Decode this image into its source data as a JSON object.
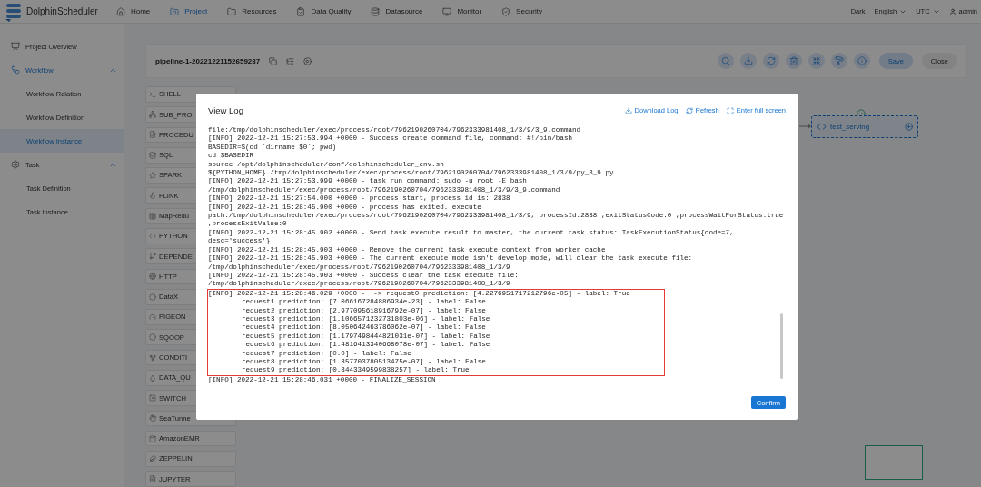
{
  "header": {
    "brand": "DolphinScheduler",
    "nav": [
      {
        "label": "Home",
        "selected": false
      },
      {
        "label": "Project",
        "selected": true
      },
      {
        "label": "Resources",
        "selected": false
      },
      {
        "label": "Data Quality",
        "selected": false
      },
      {
        "label": "Datasource",
        "selected": false
      },
      {
        "label": "Monitor",
        "selected": false
      },
      {
        "label": "Security",
        "selected": false
      }
    ],
    "theme": "Dark",
    "language": "English",
    "timezone": "UTC",
    "user": "admin"
  },
  "sidebar": {
    "items": [
      {
        "label": "Project Overview",
        "selected": false
      },
      {
        "label": "Workflow",
        "selected": false,
        "expanded": true,
        "children": [
          {
            "label": "Workflow Relation",
            "selected": false
          },
          {
            "label": "Workflow Definition",
            "selected": false
          },
          {
            "label": "Workflow Instance",
            "selected": true
          }
        ]
      },
      {
        "label": "Task",
        "selected": false,
        "expanded": true,
        "children": [
          {
            "label": "Task Definition",
            "selected": false
          },
          {
            "label": "Task Instance",
            "selected": false
          }
        ]
      }
    ]
  },
  "toolbar": {
    "title": "pipeline-1-20221221152659237",
    "buttons": [
      "Save",
      "Close"
    ]
  },
  "palette": [
    "SHELL",
    "SUB_PRO",
    "PROCEDU",
    "SQL",
    "SPARK",
    "FLINK",
    "MapRedu",
    "PYTHON",
    "DEPENDE",
    "HTTP",
    "DataX",
    "PIGEON",
    "SQOOP",
    "CONDITI",
    "DATA_QU",
    "SWITCH",
    "SeaTunne",
    "AmazonEMR",
    "ZEPPELIN",
    "JUPYTER"
  ],
  "canvas": {
    "node": {
      "label": "test_serving",
      "succeeded": true
    }
  },
  "dialog": {
    "title": "View Log",
    "actions": [
      "Download Log",
      "Refresh",
      "Enter full screen"
    ],
    "confirm": "Confirm",
    "log": [
      {
        "kind": "plain",
        "lines": [
          {
            "text": "file:/tmp/dolphinscheduler/exec/process/root/7962190260704/7962333981408_1/3/9/3_9.command"
          },
          {
            "text": "[INFO] 2022-12-21 15:27:53.994 +0000 - Success create command file, command: #!/bin/bash"
          },
          {
            "text": "BASEDIR=$(cd `dirname $0`; pwd)"
          },
          {
            "text": "cd $BASEDIR"
          },
          {
            "text": "source /opt/dolphinscheduler/conf/dolphinscheduler_env.sh"
          },
          {
            "text": "${PYTHON_HOME} /tmp/dolphinscheduler/exec/process/root/7962190260704/7962333981408_1/3/9/py_3_9.py"
          },
          {
            "text": "[INFO] 2022-12-21 15:27:53.999 +0000 - task run command: sudo -u root -E bash"
          },
          {
            "text": "/tmp/dolphinscheduler/exec/process/root/7962190260704/7962333981408_1/3/9/3_9.command"
          },
          {
            "text": "[INFO] 2022-12-21 15:27:54.000 +0000 - process start, process id is: 2838"
          },
          {
            "text": "[INFO] 2022-12-21 15:28:45.900 +0000 - process has exited. execute"
          },
          {
            "text": "path:/tmp/dolphinscheduler/exec/process/root/7962190260704/7962333981408_1/3/9, processId:2838 ,exitStatusCode:0 ,processWaitForStatus:true"
          },
          {
            "text": ",processExitValue:0"
          },
          {
            "text": "[INFO] 2022-12-21 15:28:45.902 +0000 - Send task execute result to master, the current task status: TaskExecutionStatus{code=7,"
          },
          {
            "text": "desc='success'}"
          },
          {
            "text": "[INFO] 2022-12-21 15:28:45.903 +0000 - Remove the current task execute context from worker cache"
          },
          {
            "text": "[INFO] 2022-12-21 15:28:45.903 +0000 - The current execute mode isn't develop mode, will clear the task execute file:"
          },
          {
            "text": "/tmp/dolphinscheduler/exec/process/root/7962190260704/7962333981408_1/3/9"
          },
          {
            "text": "[INFO] 2022-12-21 15:28:45.903 +0000 - Success clear the task execute file:"
          },
          {
            "text": "/tmp/dolphinscheduler/exec/process/root/7962190260704/7962333981408_1/3/9"
          }
        ]
      },
      {
        "kind": "highlight",
        "lines": [
          {
            "text": "[INFO] 2022-12-21 15:28:46.029 +0000 -  -> request0 prediction: [4.2276951717212796e-05] - label: True",
            "indented": false
          },
          {
            "text": "request1 prediction: [7.066167284886934e-23] - label: False",
            "indented": true
          },
          {
            "text": "request2 prediction: [2.977095618916792e-07] - label: False",
            "indented": true
          },
          {
            "text": "request3 prediction: [1.1066571232731803e-06] - label: False",
            "indented": true
          },
          {
            "text": "request4 prediction: [8.050642463786062e-07] - label: False",
            "indented": true
          },
          {
            "text": "request5 prediction: [1.1797498444821031e-07] - label: False",
            "indented": true
          },
          {
            "text": "request6 prediction: [1.4816413340668078e-07] - label: False",
            "indented": true
          },
          {
            "text": "request7 prediction: [0.0] - label: False",
            "indented": true
          },
          {
            "text": "request8 prediction: [1.357703780513475e-07] - label: False",
            "indented": true
          },
          {
            "text": "request9 prediction: [0.3443349599838257] - label: True",
            "indented": true
          }
        ]
      },
      {
        "kind": "plain",
        "lines": [
          {
            "text": "[INFO] 2022-12-21 15:28:46.031 +0000 - FINALIZE_SESSION"
          }
        ]
      }
    ]
  }
}
